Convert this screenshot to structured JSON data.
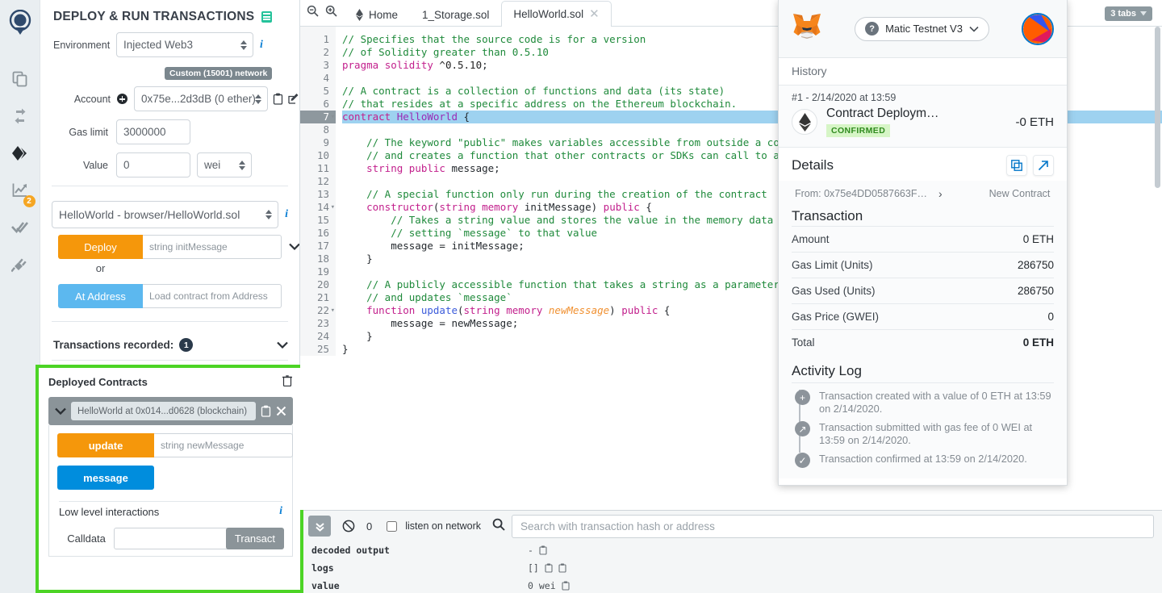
{
  "iconbar": {
    "items": [
      {
        "name": "remix-logo",
        "label": "Remix"
      },
      {
        "name": "file-explorers",
        "label": "File explorers"
      },
      {
        "name": "solidity-compiler",
        "label": "Solidity compiler"
      },
      {
        "name": "deploy-run-transactions",
        "label": "Deploy & run transactions"
      },
      {
        "name": "debugger",
        "label": "Debugger",
        "badge": "2"
      },
      {
        "name": "solidity-static-analysis",
        "label": "Solidity static analysis"
      },
      {
        "name": "plugin-manager",
        "label": "Plugin manager"
      }
    ]
  },
  "sidepanel": {
    "title": "DEPLOY & RUN TRANSACTIONS",
    "environment": {
      "label": "Environment",
      "value": "Injected Web3",
      "network_badge": "Custom (15001) network"
    },
    "account": {
      "label": "Account",
      "value": "0x75e...2d3dB (0 ether)"
    },
    "gas_limit": {
      "label": "Gas limit",
      "value": "3000000"
    },
    "value": {
      "label": "Value",
      "amount": "0",
      "unit": "wei"
    },
    "contract_select": "HelloWorld - browser/HelloWorld.sol",
    "deploy": {
      "button": "Deploy",
      "placeholder": "string initMessage"
    },
    "or": "or",
    "at_address": {
      "button": "At Address",
      "placeholder": "Load contract from Address"
    },
    "transactions_recorded": {
      "label": "Transactions recorded:",
      "count": "1"
    },
    "deployed_contracts": {
      "title": "Deployed Contracts",
      "instance": "HelloWorld at 0x014...d0628 (blockchain)",
      "functions": [
        {
          "name": "update",
          "kind": "transact",
          "placeholder": "string newMessage"
        },
        {
          "name": "message",
          "kind": "call",
          "placeholder": ""
        }
      ],
      "low_level": "Low level interactions",
      "calldata_label": "Calldata",
      "calldata_value": "",
      "transact_button": "Transact"
    }
  },
  "editor": {
    "tabs": [
      {
        "label": "Home",
        "icon": "ethereum-icon",
        "active": false,
        "closable": false
      },
      {
        "label": "1_Storage.sol",
        "active": false,
        "closable": false
      },
      {
        "label": "HelloWorld.sol",
        "active": true,
        "closable": true
      }
    ],
    "tabs_pill": "3 tabs",
    "current_line": 7,
    "lines": [
      {
        "n": 1,
        "tokens": [
          {
            "t": "// Specifies that the source code is for a version",
            "c": "cmt"
          }
        ]
      },
      {
        "n": 2,
        "tokens": [
          {
            "t": "// of Solidity greater than 0.5.10",
            "c": "cmt"
          }
        ]
      },
      {
        "n": 3,
        "tokens": [
          {
            "t": "pragma ",
            "c": "kw"
          },
          {
            "t": "solidity ",
            "c": "kw"
          },
          {
            "t": "^0.5.10",
            "c": "num"
          },
          {
            "t": ";",
            "c": "plain"
          }
        ]
      },
      {
        "n": 4,
        "tokens": []
      },
      {
        "n": 5,
        "tokens": [
          {
            "t": "// A contract is a collection of functions and data (its state)",
            "c": "cmt"
          }
        ]
      },
      {
        "n": 6,
        "tokens": [
          {
            "t": "// that resides at a specific address on the Ethereum blockchain.",
            "c": "cmt"
          }
        ]
      },
      {
        "n": 7,
        "fold": true,
        "hl": true,
        "tokens": [
          {
            "t": "contract ",
            "c": "kw"
          },
          {
            "t": "HelloWorld",
            "c": "kw2"
          },
          {
            "t": " {",
            "c": "plain"
          }
        ]
      },
      {
        "n": 8,
        "tokens": []
      },
      {
        "n": 9,
        "tokens": [
          {
            "t": "    // The keyword \"public\" makes variables accessible from outside a contr",
            "c": "cmt"
          }
        ]
      },
      {
        "n": 10,
        "tokens": [
          {
            "t": "    // and creates a function that other contracts or SDKs can call to acce",
            "c": "cmt"
          }
        ]
      },
      {
        "n": 11,
        "tokens": [
          {
            "t": "    ",
            "c": "plain"
          },
          {
            "t": "string ",
            "c": "kw"
          },
          {
            "t": "public ",
            "c": "kw"
          },
          {
            "t": "message;",
            "c": "plain"
          }
        ]
      },
      {
        "n": 12,
        "tokens": []
      },
      {
        "n": 13,
        "tokens": [
          {
            "t": "    // A special function only run during the creation of the contract",
            "c": "cmt"
          }
        ]
      },
      {
        "n": 14,
        "fold": true,
        "tokens": [
          {
            "t": "    ",
            "c": "plain"
          },
          {
            "t": "constructor",
            "c": "kw"
          },
          {
            "t": "(",
            "c": "plain"
          },
          {
            "t": "string ",
            "c": "kw"
          },
          {
            "t": "memory ",
            "c": "kw"
          },
          {
            "t": "initMessage",
            "c": "plain"
          },
          {
            "t": ") ",
            "c": "plain"
          },
          {
            "t": "public",
            "c": "kw"
          },
          {
            "t": " {",
            "c": "plain"
          }
        ]
      },
      {
        "n": 15,
        "tokens": [
          {
            "t": "        // Takes a string value and stores the value in the memory data sto",
            "c": "cmt"
          }
        ]
      },
      {
        "n": 16,
        "tokens": [
          {
            "t": "        // setting `message` to that value",
            "c": "cmt"
          }
        ]
      },
      {
        "n": 17,
        "tokens": [
          {
            "t": "        message = initMessage;",
            "c": "plain"
          }
        ]
      },
      {
        "n": 18,
        "tokens": [
          {
            "t": "    }",
            "c": "plain"
          }
        ]
      },
      {
        "n": 19,
        "tokens": []
      },
      {
        "n": 20,
        "tokens": [
          {
            "t": "    // A publicly accessible function that takes a string as a parameter",
            "c": "cmt"
          }
        ]
      },
      {
        "n": 21,
        "tokens": [
          {
            "t": "    // and updates `message`",
            "c": "cmt"
          }
        ]
      },
      {
        "n": 22,
        "fold": true,
        "tokens": [
          {
            "t": "    ",
            "c": "plain"
          },
          {
            "t": "function ",
            "c": "kw"
          },
          {
            "t": "update",
            "c": "fn"
          },
          {
            "t": "(",
            "c": "plain"
          },
          {
            "t": "string ",
            "c": "kw"
          },
          {
            "t": "memory ",
            "c": "kw"
          },
          {
            "t": "newMessage",
            "c": "param"
          },
          {
            "t": ") ",
            "c": "plain"
          },
          {
            "t": "public",
            "c": "kw"
          },
          {
            "t": " {",
            "c": "plain"
          }
        ]
      },
      {
        "n": 23,
        "tokens": [
          {
            "t": "        message = newMessage;",
            "c": "plain"
          }
        ]
      },
      {
        "n": 24,
        "tokens": [
          {
            "t": "    }",
            "c": "plain"
          }
        ]
      },
      {
        "n": 25,
        "tokens": [
          {
            "t": "}",
            "c": "plain"
          }
        ]
      }
    ]
  },
  "terminal": {
    "count": "0",
    "listen_label": "listen on network",
    "listen_checked": false,
    "search_placeholder": "Search with transaction hash or address",
    "search_value": "",
    "log_rows": [
      {
        "key": "decoded output",
        "value": "-",
        "clips": 1
      },
      {
        "key": "logs",
        "value": "[]",
        "clips": 2
      },
      {
        "key": "value",
        "value": "0 wei",
        "clips": 1
      }
    ]
  },
  "metamask": {
    "network": "Matic Testnet V3",
    "history_label": "History",
    "tx": {
      "date": "#1 - 2/14/2020 at 13:59",
      "title": "Contract Deploym…",
      "status": "CONFIRMED",
      "amount": "-0 ETH"
    },
    "details_label": "Details",
    "from": "From: 0x75e4DD0587663F…",
    "to": "New Contract",
    "transaction_label": "Transaction",
    "rows": [
      {
        "k": "Amount",
        "v": "0 ETH"
      },
      {
        "k": "Gas Limit (Units)",
        "v": "286750"
      },
      {
        "k": "Gas Used (Units)",
        "v": "286750"
      },
      {
        "k": "Gas Price (GWEI)",
        "v": "0"
      },
      {
        "k": "Total",
        "v": "0 ETH",
        "bold": true
      }
    ],
    "activity_label": "Activity Log",
    "activity": [
      {
        "icon": "+",
        "text": "Transaction created with a value of 0 ETH at 13:59 on 2/14/2020."
      },
      {
        "icon": "↗",
        "text": "Transaction submitted with gas fee of 0 WEI at 13:59 on 2/14/2020."
      },
      {
        "icon": "✓",
        "text": "Transaction confirmed at 13:59 on 2/14/2020."
      }
    ]
  },
  "colors": {
    "accent_orange": "#f5970b",
    "accent_blue": "#008ddd",
    "highlight_green": "#4cd425",
    "confirmed_green": "#2f8b1e",
    "metamask_blue": "#0376c9"
  }
}
